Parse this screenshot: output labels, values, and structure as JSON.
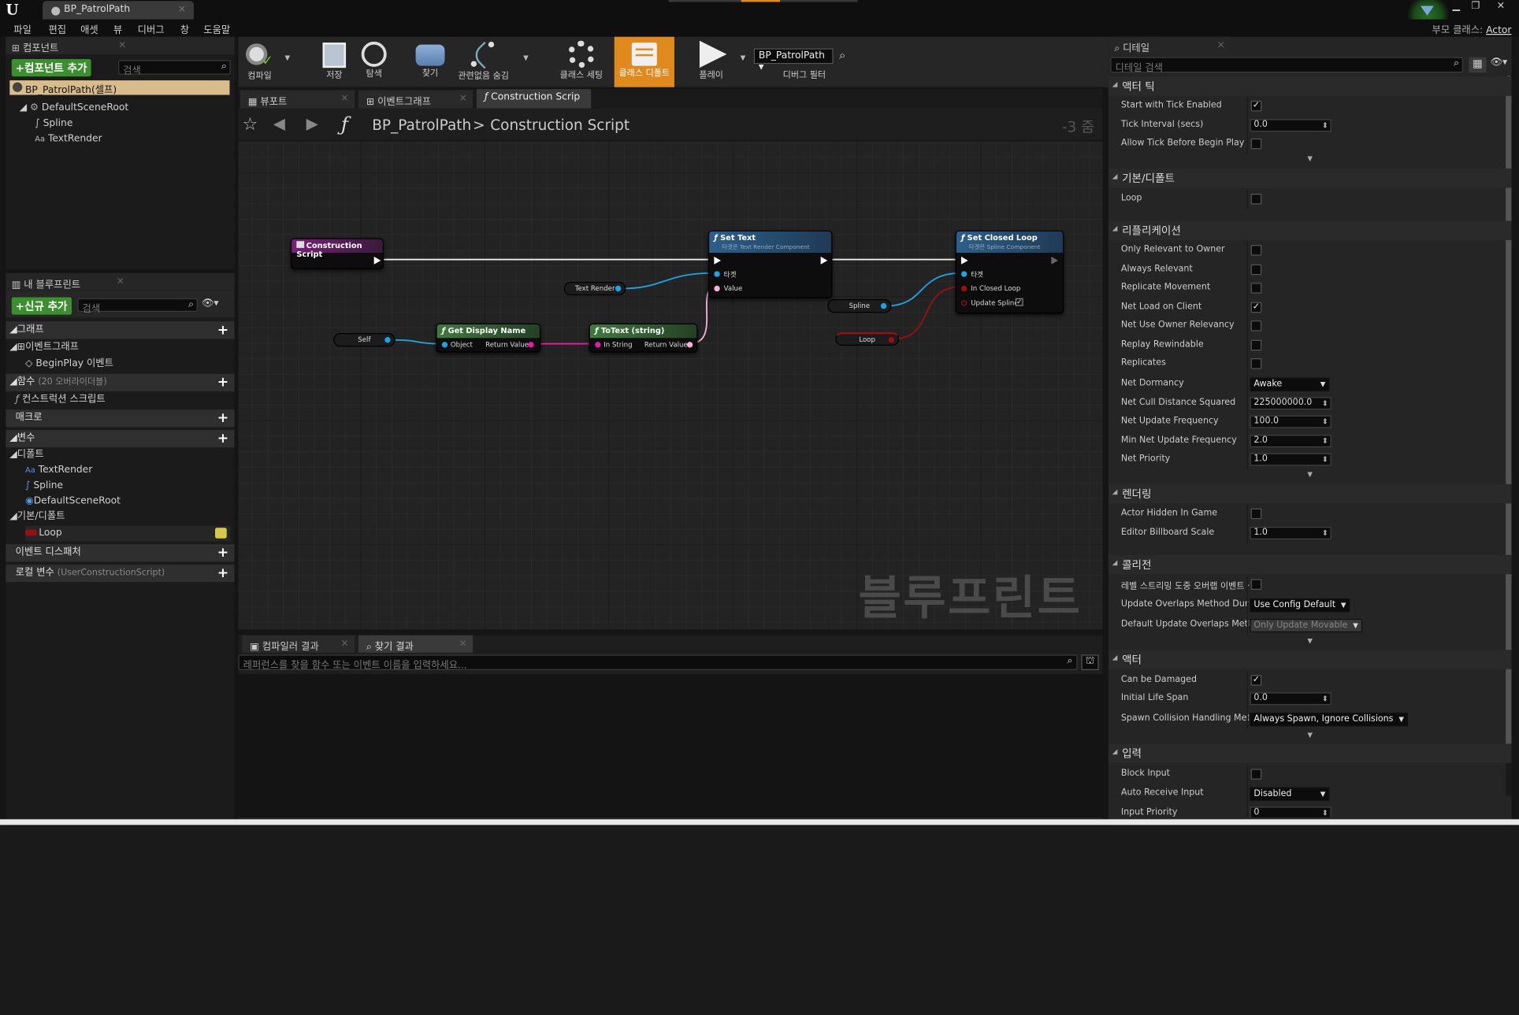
{
  "window": {
    "tab_title": "BP_PatrolPath",
    "parent_class_label": "부모 클래스:",
    "parent_class_value": "Actor"
  },
  "menu": [
    "파일",
    "편집",
    "애셋",
    "뷰",
    "디버그",
    "창",
    "도움말"
  ],
  "components_panel": {
    "title": "컴포넌트",
    "add_button": "+컴포넌트 추가",
    "search_placeholder": "검색",
    "self_item": "BP_PatrolPath(셀프)",
    "tree": [
      "DefaultSceneRoot",
      "Spline",
      "TextRender"
    ]
  },
  "my_blueprint": {
    "title": "내 블루프린트",
    "add_button": "+신규 추가",
    "search_placeholder": "검색",
    "graphs_label": "그래프",
    "event_graph": "이벤트그래프",
    "begin_play": "BeginPlay 이벤트",
    "functions_label": "함수",
    "functions_suffix": "(20 오버라이더블)",
    "construction_script": "컨스트럭션 스크립트",
    "macros_label": "매크로",
    "variables_label": "변수",
    "components_category": "디폴트",
    "var_components": [
      "TextRender",
      "Spline",
      "DefaultSceneRoot"
    ],
    "default_category": "기본/디폴트",
    "loop_var": "Loop",
    "event_dispatchers": "이벤트 디스패처",
    "local_vars": "로컬 변수",
    "local_vars_suffix": "(UserConstructionScript)"
  },
  "toolbar": {
    "compile": "컴파일",
    "save": "저장",
    "browse": "탐색",
    "find": "찾기",
    "hide_unrelated": "관련없음 숨김",
    "class_settings": "클래스 세팅",
    "class_defaults": "클래스 디폴트",
    "play": "플레이",
    "debug_object": "BP_PatrolPath",
    "debug_filter": "디버그 필터"
  },
  "editor_tabs": [
    "뷰포트",
    "이벤트그래프",
    "Construction Scrip"
  ],
  "graph": {
    "breadcrumb_root": "BP_PatrolPath",
    "breadcrumb_sep": ">",
    "breadcrumb_leaf": "Construction Script",
    "zoom": "-3 줌",
    "watermark": "블루프린트",
    "nodes": {
      "construction": "Construction Script",
      "set_text": "Set Text",
      "set_text_sub": "타겟은 Text Render Component",
      "set_closed_loop": "Set Closed Loop",
      "set_closed_loop_sub": "타겟은 Spline Component",
      "get_display_name": "Get Display Name",
      "to_text": "ToText (string)",
      "text_render": "Text Render",
      "self": "Self",
      "spline": "Spline",
      "loop": "Loop",
      "pin_target": "타겟",
      "pin_value": "Value",
      "pin_object": "Object",
      "pin_return": "Return Value",
      "pin_instring": "In String",
      "pin_closed": "In Closed Loop",
      "pin_update": "Update Spline"
    }
  },
  "bottom_tabs": [
    "컴파일러 결과",
    "찾기 결과"
  ],
  "bottom_search_placeholder": "레퍼런스를 찾을 함수 또는 이벤트 이름을 입력하세요...",
  "details": {
    "title": "디테일",
    "search_placeholder": "디테일 검색",
    "sections": {
      "tick": "액터 틱",
      "defaults": "기본/디폴트",
      "replication": "리플리케이션",
      "rendering": "렌더링",
      "collision": "콜리전",
      "actor": "액터",
      "input": "입력"
    },
    "rows": {
      "start_tick": "Start with Tick Enabled",
      "tick_interval": "Tick Interval (secs)",
      "tick_interval_val": "0.0",
      "allow_tick": "Allow Tick Before Begin Play",
      "loop": "Loop",
      "only_relevant": "Only Relevant to Owner",
      "always_relevant": "Always Relevant",
      "replicate_movement": "Replicate Movement",
      "net_load": "Net Load on Client",
      "net_owner": "Net Use Owner Relevancy",
      "replay": "Replay Rewindable",
      "replicates": "Replicates",
      "net_dormancy": "Net Dormancy",
      "net_dormancy_val": "Awake",
      "net_cull": "Net Cull Distance Squared",
      "net_cull_val": "225000000.0",
      "net_update": "Net Update Frequency",
      "net_update_val": "100.0",
      "min_net_update": "Min Net Update Frequency",
      "min_net_update_val": "2.0",
      "net_priority": "Net Priority",
      "net_priority_val": "1.0",
      "hidden": "Actor Hidden In Game",
      "billboard": "Editor Billboard Scale",
      "billboard_val": "1.0",
      "level_streaming": "레벨 스트리밍 도중 오버랩 이벤트 생성",
      "update_overlaps": "Update Overlaps Method During Level Streaming",
      "update_overlaps_val": "Use Config Default",
      "default_overlaps": "Default Update Overlaps Method During Level Streaming",
      "default_overlaps_val": "Only Update Movable",
      "can_damage": "Can be Damaged",
      "life_span": "Initial Life Span",
      "life_span_val": "0.0",
      "spawn_collision": "Spawn Collision Handling Method",
      "spawn_collision_val": "Always Spawn, Ignore Collisions",
      "block_input": "Block Input",
      "auto_receive": "Auto Receive Input",
      "auto_receive_val": "Disabled",
      "input_priority": "Input Priority",
      "input_priority_val": "0"
    }
  },
  "colors": {
    "accent_orange": "#e08a1e",
    "green_button": "#3b8f2e",
    "exec_wire": "#ffffff",
    "object_pin": "#1fa3e0",
    "string_pin": "#e020a0",
    "bool_pin": "#9a1010"
  }
}
